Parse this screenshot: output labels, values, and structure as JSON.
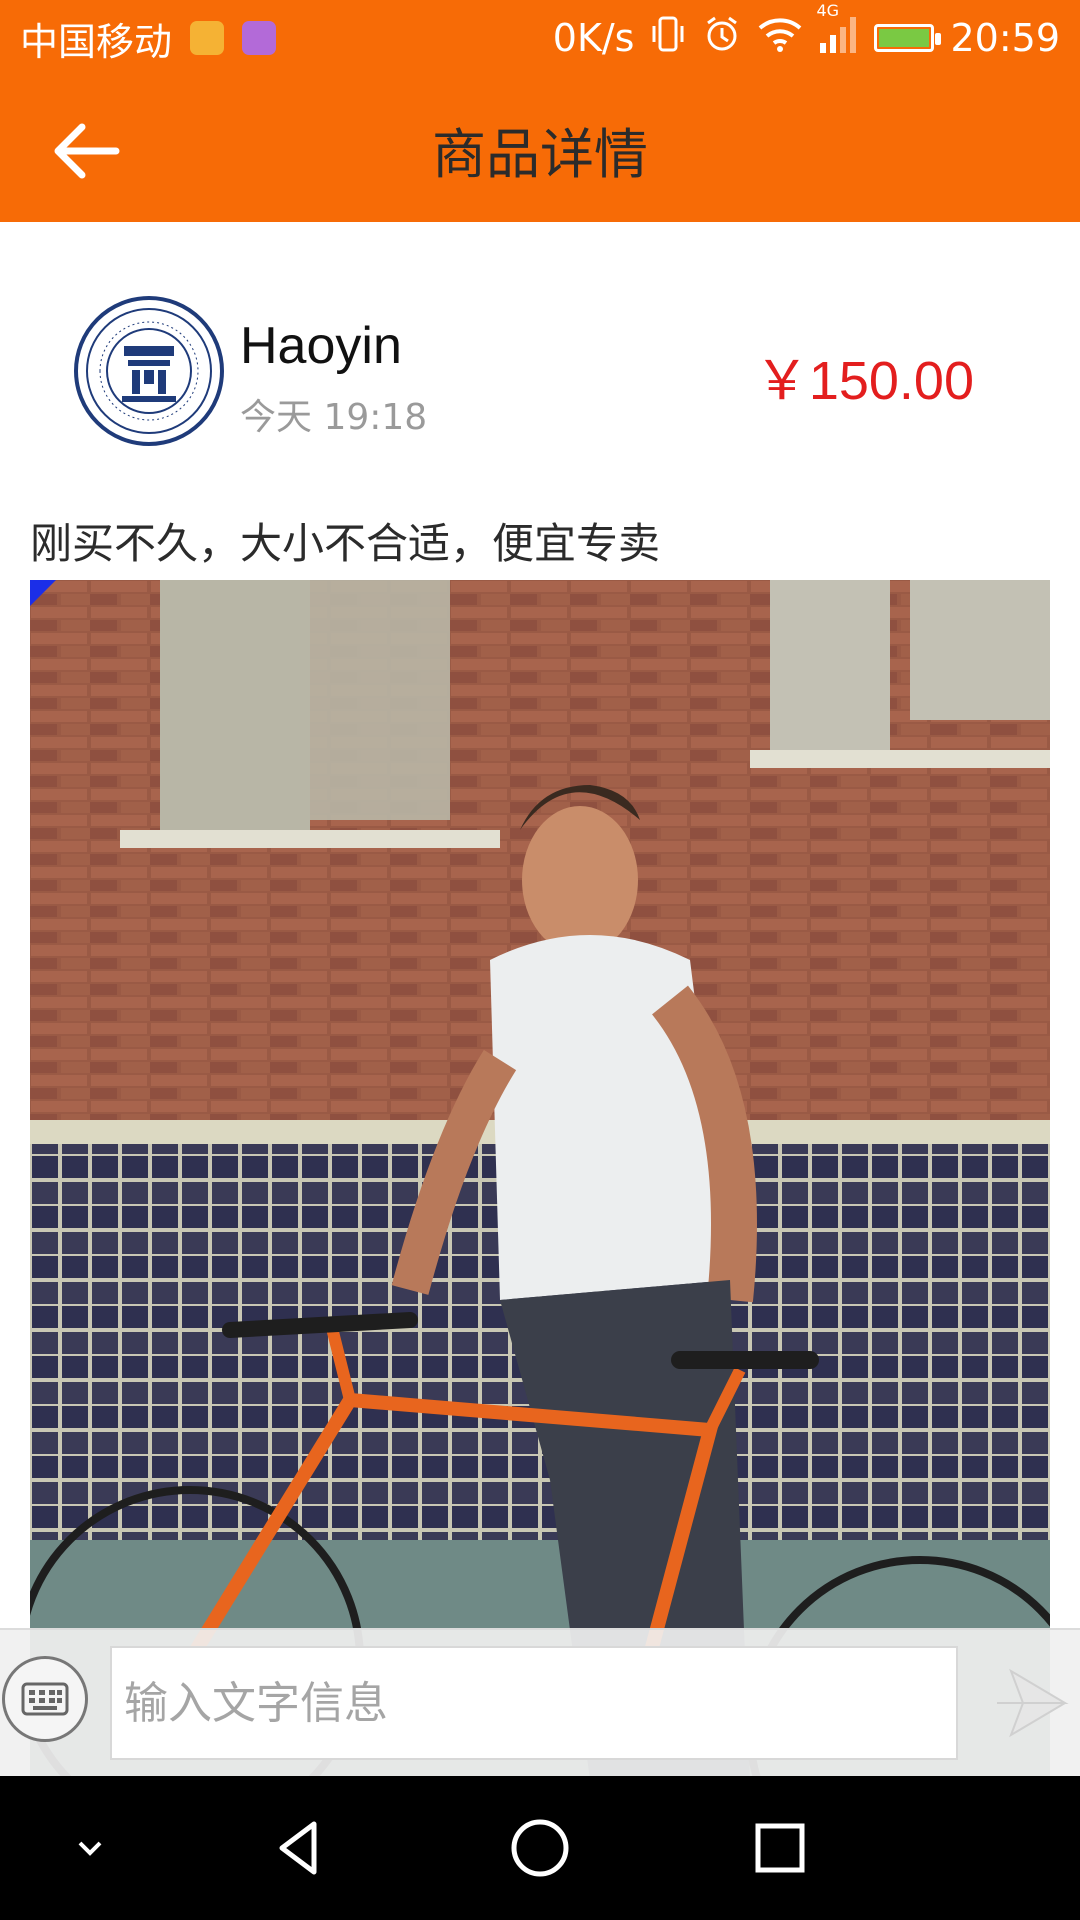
{
  "status_bar": {
    "carrier": "中国移动",
    "net_speed": "0K/s",
    "network": "4G",
    "time": "20:59",
    "icons": [
      "app-notification-icon",
      "gallery-notification-icon",
      "vibrate-icon",
      "alarm-icon",
      "wifi-icon",
      "signal-icon",
      "battery-icon"
    ]
  },
  "header": {
    "title": "商品详情",
    "back_icon": "arrow-left-icon"
  },
  "seller": {
    "name": "Haoyin",
    "time": "今天 19:18",
    "avatar_logo_text": "ANYANG INSTITUTE OF TECHNOLOGY"
  },
  "product": {
    "price": "￥150.00",
    "description": "刚买不久，大小不合适，便宜专卖"
  },
  "input_bar": {
    "placeholder": "输入文字信息",
    "value": ""
  },
  "colors": {
    "accent": "#f76b06",
    "price": "#e31e1e"
  }
}
